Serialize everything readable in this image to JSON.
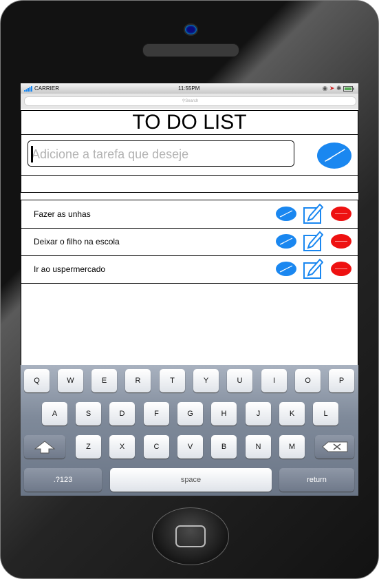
{
  "status_bar": {
    "carrier": "CARRIER",
    "time": "11:55PM"
  },
  "search_bar": {
    "placeholder": "Search"
  },
  "app": {
    "title": "TO DO LIST",
    "input_placeholder": "Adicione a tarefa que deseje"
  },
  "tasks": [
    {
      "label": "Fazer as unhas"
    },
    {
      "label": "Deixar o filho na escola"
    },
    {
      "label": "Ir ao uspermercado"
    }
  ],
  "colors": {
    "accent_blue": "#1a87f0",
    "delete_red": "#ee1111"
  },
  "icons": {
    "confirm": "check-icon",
    "edit": "edit-pencil-icon",
    "delete": "minus-icon"
  },
  "keyboard": {
    "row1": [
      "Q",
      "W",
      "E",
      "R",
      "T",
      "Y",
      "U",
      "I",
      "O",
      "P"
    ],
    "row2": [
      "A",
      "S",
      "D",
      "F",
      "G",
      "H",
      "J",
      "K",
      "L"
    ],
    "row3": [
      "Z",
      "X",
      "C",
      "V",
      "B",
      "N",
      "M"
    ],
    "numbers_label": ".?123",
    "space_label": "space",
    "return_label": "return"
  }
}
